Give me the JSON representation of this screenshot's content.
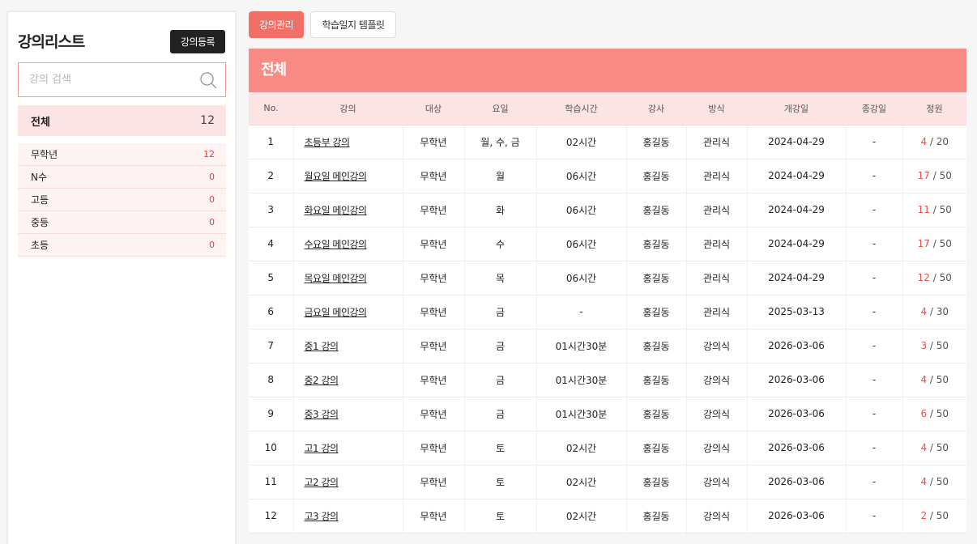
{
  "sidebar": {
    "title": "강의리스트",
    "register_label": "강의등록",
    "search_placeholder": "강의 검색",
    "all": {
      "label": "전체",
      "count": "12"
    },
    "categories": [
      {
        "label": "무학년",
        "count": "12"
      },
      {
        "label": "N수",
        "count": "0"
      },
      {
        "label": "고등",
        "count": "0"
      },
      {
        "label": "중등",
        "count": "0"
      },
      {
        "label": "초등",
        "count": "0"
      }
    ]
  },
  "tabs": [
    {
      "label": "강의관리",
      "active": true
    },
    {
      "label": "학습일지 템플릿",
      "active": false
    }
  ],
  "panel": {
    "heading": "전체",
    "columns": [
      "No.",
      "강의",
      "대상",
      "요일",
      "학습시간",
      "강사",
      "방식",
      "개강일",
      "종강일",
      "정원"
    ],
    "rows": [
      {
        "no": "1",
        "name": "초등부 강의",
        "target": "무학년",
        "days": "월, 수, 금",
        "time": "02시간",
        "teacher": "홍길동",
        "method": "관리식",
        "start": "2024-04-29",
        "end": "-",
        "enrolled": "4",
        "capacity": "20"
      },
      {
        "no": "2",
        "name": "월요일 메인강의",
        "target": "무학년",
        "days": "월",
        "time": "06시간",
        "teacher": "홍길동",
        "method": "관리식",
        "start": "2024-04-29",
        "end": "-",
        "enrolled": "17",
        "capacity": "50"
      },
      {
        "no": "3",
        "name": "화요일 메인강의",
        "target": "무학년",
        "days": "화",
        "time": "06시간",
        "teacher": "홍길동",
        "method": "관리식",
        "start": "2024-04-29",
        "end": "-",
        "enrolled": "11",
        "capacity": "50"
      },
      {
        "no": "4",
        "name": "수요일 메인강의",
        "target": "무학년",
        "days": "수",
        "time": "06시간",
        "teacher": "홍길동",
        "method": "관리식",
        "start": "2024-04-29",
        "end": "-",
        "enrolled": "17",
        "capacity": "50"
      },
      {
        "no": "5",
        "name": "목요일 메인강의",
        "target": "무학년",
        "days": "목",
        "time": "06시간",
        "teacher": "홍길동",
        "method": "관리식",
        "start": "2024-04-29",
        "end": "-",
        "enrolled": "12",
        "capacity": "50"
      },
      {
        "no": "6",
        "name": "금요일 메인강의",
        "target": "무학년",
        "days": "금",
        "time": "-",
        "teacher": "홍길동",
        "method": "관리식",
        "start": "2025-03-13",
        "end": "-",
        "enrolled": "4",
        "capacity": "30"
      },
      {
        "no": "7",
        "name": "중1 강의",
        "target": "무학년",
        "days": "금",
        "time": "01시간30분",
        "teacher": "홍길동",
        "method": "강의식",
        "start": "2026-03-06",
        "end": "-",
        "enrolled": "3",
        "capacity": "50"
      },
      {
        "no": "8",
        "name": "중2 강의",
        "target": "무학년",
        "days": "금",
        "time": "01시간30분",
        "teacher": "홍길동",
        "method": "강의식",
        "start": "2026-03-06",
        "end": "-",
        "enrolled": "4",
        "capacity": "50"
      },
      {
        "no": "9",
        "name": "중3 강의",
        "target": "무학년",
        "days": "금",
        "time": "01시간30분",
        "teacher": "홍길동",
        "method": "강의식",
        "start": "2026-03-06",
        "end": "-",
        "enrolled": "6",
        "capacity": "50"
      },
      {
        "no": "10",
        "name": "고1 강의",
        "target": "무학년",
        "days": "토",
        "time": "02시간",
        "teacher": "홍길동",
        "method": "강의식",
        "start": "2026-03-06",
        "end": "-",
        "enrolled": "4",
        "capacity": "50"
      },
      {
        "no": "11",
        "name": "고2 강의",
        "target": "무학년",
        "days": "토",
        "time": "02시간",
        "teacher": "홍길동",
        "method": "강의식",
        "start": "2026-03-06",
        "end": "-",
        "enrolled": "4",
        "capacity": "50"
      },
      {
        "no": "12",
        "name": "고3 강의",
        "target": "무학년",
        "days": "토",
        "time": "02시간",
        "teacher": "홍길동",
        "method": "강의식",
        "start": "2026-03-06",
        "end": "-",
        "enrolled": "2",
        "capacity": "50"
      }
    ]
  },
  "colors": {
    "accent": "#f26f67",
    "header_bg": "#f88b83",
    "highlight_bg": "#fbe4e3",
    "count_red": "#e5534b"
  },
  "icons": {
    "search": "search-icon"
  }
}
